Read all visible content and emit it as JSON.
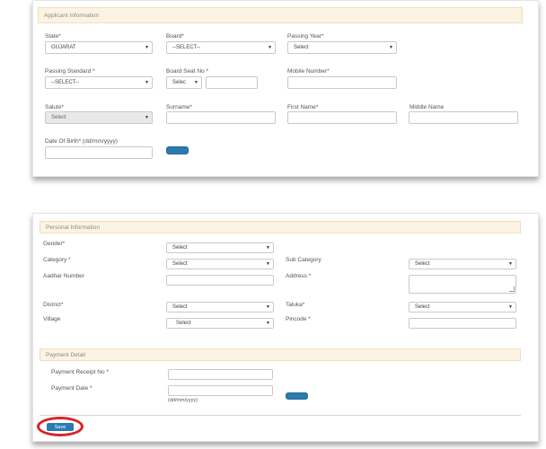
{
  "applicant": {
    "title": "Applicant Information",
    "state": {
      "label": "State*",
      "value": "GUJARAT"
    },
    "board": {
      "label": "Board*",
      "value": "--SELECT--"
    },
    "passing_year": {
      "label": "Passing Year*",
      "value": "Select"
    },
    "passing_standard": {
      "label": "Passing Standard *",
      "value": "--SELECT--"
    },
    "board_seat_no": {
      "label": "Board Seat No *",
      "prefix": "Selec",
      "value": ""
    },
    "mobile": {
      "label": "Mobile Number*",
      "value": ""
    },
    "salute": {
      "label": "Salute*",
      "value": "Select"
    },
    "surname": {
      "label": "Surname*",
      "value": ""
    },
    "first_name": {
      "label": "First Name*",
      "value": ""
    },
    "middle_name": {
      "label": "Middle Name",
      "value": ""
    },
    "dob": {
      "label": "Date Of Birth* (dd/mm/yyyy)",
      "value": ""
    }
  },
  "personal": {
    "title": "Personal Information",
    "gender": {
      "label": "Gender*",
      "value": "Select"
    },
    "category": {
      "label": "Category *",
      "value": "Select"
    },
    "sub_category": {
      "label": "Sub Category",
      "value": "Select"
    },
    "aadhar": {
      "label": "Aadhar Number",
      "value": ""
    },
    "address": {
      "label": "Address *",
      "value": ""
    },
    "district": {
      "label": "District*",
      "value": "Select"
    },
    "taluka": {
      "label": "Taluka*",
      "value": "Select"
    },
    "village": {
      "label": "Village",
      "value": "Select"
    },
    "pincode": {
      "label": "Pincode *",
      "value": ""
    }
  },
  "payment": {
    "title": "Payment Detail",
    "receipt": {
      "label": "Payment Receipt No *",
      "value": ""
    },
    "date": {
      "label": "Payment Date *",
      "value": "",
      "hint": "(dd/mm/yyyy)"
    }
  },
  "actions": {
    "save_label": "Save"
  },
  "icons": {
    "caret": "chevron-down-icon"
  },
  "colors": {
    "accent": "#2a7bb0",
    "section_bg": "#fcf3e2",
    "highlight": "#d9232a"
  }
}
